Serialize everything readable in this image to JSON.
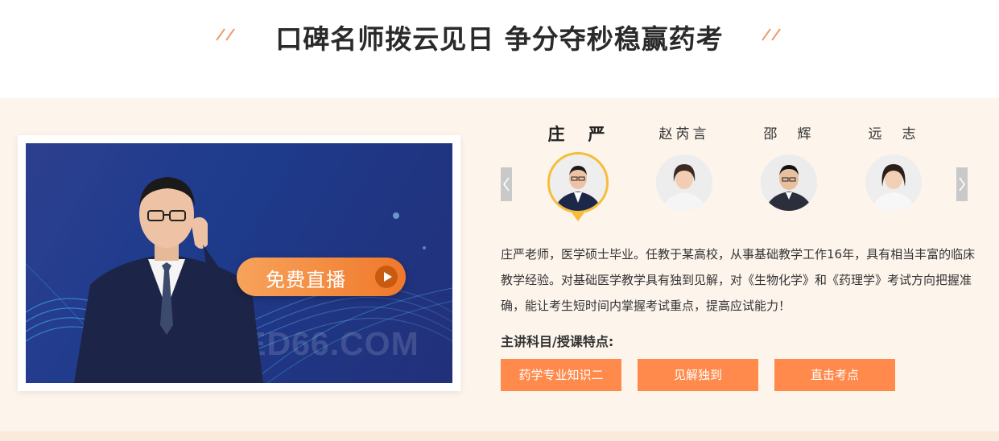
{
  "header": {
    "title": "口碑名师拨云见日 争分夺秒稳赢药考"
  },
  "video": {
    "play_label": "免费直播",
    "watermark": "MED66.COM"
  },
  "teachers": {
    "items": [
      {
        "name": "庄　严",
        "active": true
      },
      {
        "name": "赵芮言",
        "active": false
      },
      {
        "name": "邵　辉",
        "active": false
      },
      {
        "name": "远　志",
        "active": false
      }
    ]
  },
  "detail": {
    "description": "庄严老师，医学硕士毕业。任教于某高校，从事基础教学工作16年，具有相当丰富的临床教学经验。对基础医学教学具有独到见解，对《生物化学》和《药理学》考试方向把握准确，能让考生短时间内掌握考试重点，提高应试能力！",
    "subjects_label": "主讲科目/授课特点:",
    "tags": [
      "药学专业知识二",
      "见解独到",
      "直击考点"
    ]
  },
  "colors": {
    "accent": "#ff8a4c",
    "panel_bg": "#fdf4ec",
    "highlight": "#f7bd38"
  }
}
